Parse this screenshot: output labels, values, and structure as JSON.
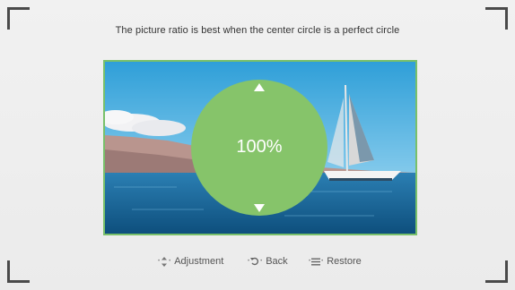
{
  "instruction": "The picture ratio is best when the center circle is a perfect circle",
  "zoom_value": "100%",
  "hints": {
    "adjustment": "Adjustment",
    "back": "Back",
    "restore": "Restore"
  },
  "icons": {
    "adjustment": "up-down-icon",
    "back": "back-icon",
    "restore": "menu-icon"
  },
  "colors": {
    "accent_green": "#86c46a",
    "frame_green": "#79c06a"
  }
}
